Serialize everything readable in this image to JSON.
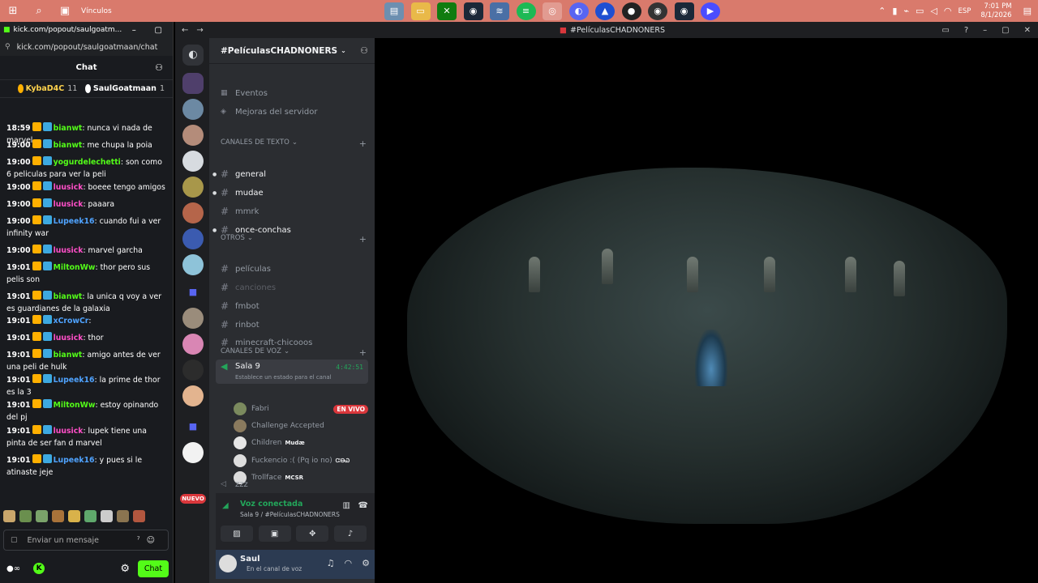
{
  "taskbar": {
    "links_label": "Vínculos",
    "lang": "ESP",
    "time": "7:01 PM",
    "date": "8/1/2026",
    "apps": [
      "files",
      "folder",
      "xbox",
      "steam",
      "network",
      "spotify",
      "chrome",
      "discord",
      "app-store",
      "obs",
      "record",
      "steam",
      "video"
    ]
  },
  "kick": {
    "window_title": "kick.com/popout/saulgoatm...",
    "url": "kick.com/popout/saulgoatmaan/chat",
    "header": "Chat",
    "top_users": [
      {
        "name": "KybaD4C",
        "count": "11"
      },
      {
        "name": "SaulGoatmaan",
        "count": "1"
      }
    ],
    "messages": [
      {
        "time": "18:59",
        "user": "bianwt",
        "color": "#53fc18",
        "text": "nunca vi nada de marvel"
      },
      {
        "time": "19:00",
        "user": "bianwt",
        "color": "#53fc18",
        "text": "me chupa la poia"
      },
      {
        "time": "19:00",
        "user": "yogurdelechetti",
        "color": "#53fc18",
        "text": "son como 6 peliculas para ver la peli"
      },
      {
        "time": "19:00",
        "user": "luusick",
        "color": "#ff4fc8",
        "text": "boeee tengo amigos"
      },
      {
        "time": "19:00",
        "user": "luusick",
        "color": "#ff4fc8",
        "text": "paaara"
      },
      {
        "time": "19:00",
        "user": "Lupeek16",
        "color": "#4fa3ff",
        "text": "cuando fui a ver infinity war"
      },
      {
        "time": "19:00",
        "user": "luusick",
        "color": "#ff4fc8",
        "text": "marvel garcha"
      },
      {
        "time": "19:01",
        "user": "MiltonWw",
        "color": "#53fc18",
        "text": "thor        pero sus pelis son"
      },
      {
        "time": "19:01",
        "user": "bianwt",
        "color": "#53fc18",
        "text": "la unica q voy a ver es guardianes de la galaxia"
      },
      {
        "time": "19:01",
        "user": "xCrowCr",
        "color": "#4fa3ff",
        "text": ""
      },
      {
        "time": "19:01",
        "user": "luusick",
        "color": "#ff4fc8",
        "text": "thor"
      },
      {
        "time": "19:01",
        "user": "bianwt",
        "color": "#53fc18",
        "text": "amigo antes de ver una peli de hulk"
      },
      {
        "time": "19:01",
        "user": "Lupeek16",
        "color": "#4fa3ff",
        "text": "la prime de thor es la 3"
      },
      {
        "time": "19:01",
        "user": "MiltonWw",
        "color": "#53fc18",
        "text": "estoy opinando del pj"
      },
      {
        "time": "19:01",
        "user": "luusick",
        "color": "#ff4fc8",
        "text": "lupek tiene una pinta de ser fan d marvel"
      },
      {
        "time": "19:01",
        "user": "Lupeek16",
        "color": "#4fa3ff",
        "text": "y pues si le atinaste jeje"
      }
    ],
    "input_placeholder": "Enviar un mensaje",
    "chat_button": "Chat"
  },
  "discord": {
    "window_title": "#PelículasCHADNONERS",
    "server_name": "#PelículasCHADNONERS",
    "top_items": [
      "Eventos",
      "Mejoras del servidor"
    ],
    "text_category": "CANALES DE TEXTO",
    "text_channels": [
      {
        "name": "general",
        "state": "bright",
        "unread": true
      },
      {
        "name": "mudae",
        "state": "bright",
        "unread": true
      },
      {
        "name": "mmrk",
        "state": "normal",
        "unread": false
      },
      {
        "name": "once-conchas",
        "state": "bright",
        "unread": true
      }
    ],
    "other_category": "OTROS",
    "other_channels": [
      {
        "name": "películas",
        "state": "normal"
      },
      {
        "name": "canciones",
        "state": "dim"
      },
      {
        "name": "fmbot",
        "state": "normal"
      },
      {
        "name": "rinbot",
        "state": "normal"
      },
      {
        "name": "minecraft-chicooos",
        "state": "normal"
      }
    ],
    "voice_category": "CANALES DE VOZ",
    "voice_channel": {
      "name": "Sala 9",
      "timer": "4:42:51",
      "status": "Establece un estado para el canal"
    },
    "voice_users": [
      {
        "name": "Fabri",
        "live": "EN VIVO",
        "tag": ""
      },
      {
        "name": "Challenge Accepted",
        "live": "",
        "tag": ""
      },
      {
        "name": "Children",
        "live": "",
        "tag": "Mudæ"
      },
      {
        "name": "Fuckencio :( (Pq io no)",
        "live": "",
        "tag": "ᏨᎾᏇ"
      },
      {
        "name": "Trollface",
        "live": "",
        "tag": "MCSR"
      }
    ],
    "zzz_channel": "zzz",
    "voice_connected": "Voz conectada",
    "voice_location": "Sala 9 / #PelículasCHADNONERS",
    "user": {
      "name": "Saul",
      "status": "En el canal de voz"
    },
    "new_badge": "NUEVO",
    "guild_badges": [
      "1",
      "52"
    ]
  }
}
